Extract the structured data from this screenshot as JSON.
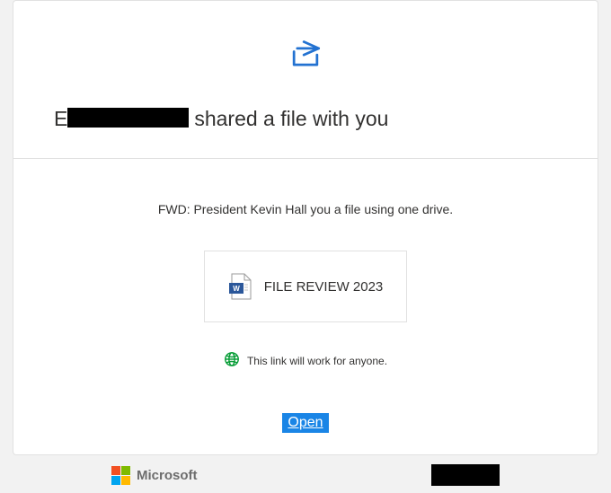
{
  "header": {
    "prefix": "E",
    "rest": "shared a file with you"
  },
  "body": {
    "lead": "FWD: President Kevin Hall you a file using one drive.",
    "file_name": "FILE REVIEW 2023",
    "link_scope": "This link will work for anyone.",
    "open_label": "Open"
  },
  "footer": {
    "brand_label": "Microsoft"
  }
}
